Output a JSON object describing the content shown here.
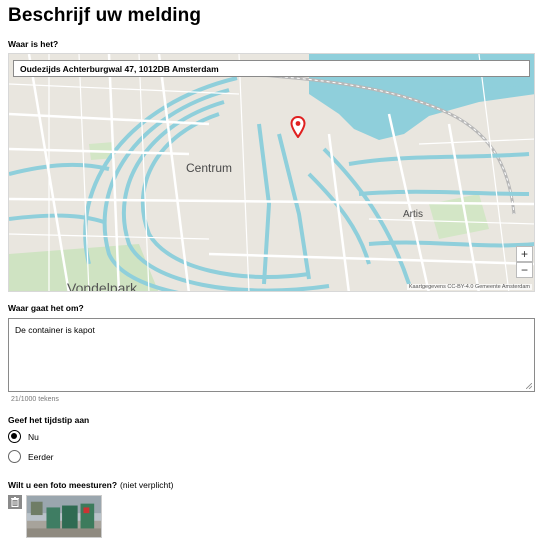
{
  "page": {
    "title": "Beschrijf uw melding"
  },
  "location": {
    "label": "Waar is het?",
    "address": "Oudezijds Achterburgwal 47, 1012DB Amsterdam"
  },
  "map": {
    "labels": {
      "centrum": "Centrum",
      "artis": "Artis",
      "vondelpark": "Vondelpark"
    },
    "zoom_in": "+",
    "zoom_out": "−",
    "attribution": "Kaartgegevens CC-BY-4.0 Gemeente Amsterdam",
    "marker_icon": "map-pin-icon",
    "colors": {
      "water": "#8fcfdb",
      "land": "#e9e6df",
      "roads": "#ffffff",
      "marker": "#e02020"
    }
  },
  "description": {
    "label": "Waar gaat het om?",
    "value": "De container is kapot",
    "char_count": "21/1000 tekens"
  },
  "time": {
    "label": "Geef het tijdstip aan",
    "options": [
      {
        "label": "Nu",
        "checked": true
      },
      {
        "label": "Eerder",
        "checked": false
      }
    ]
  },
  "photo": {
    "label": "Wilt u een foto meesturen?",
    "optional": "(niet verplicht)",
    "delete_icon": "trash-icon"
  }
}
